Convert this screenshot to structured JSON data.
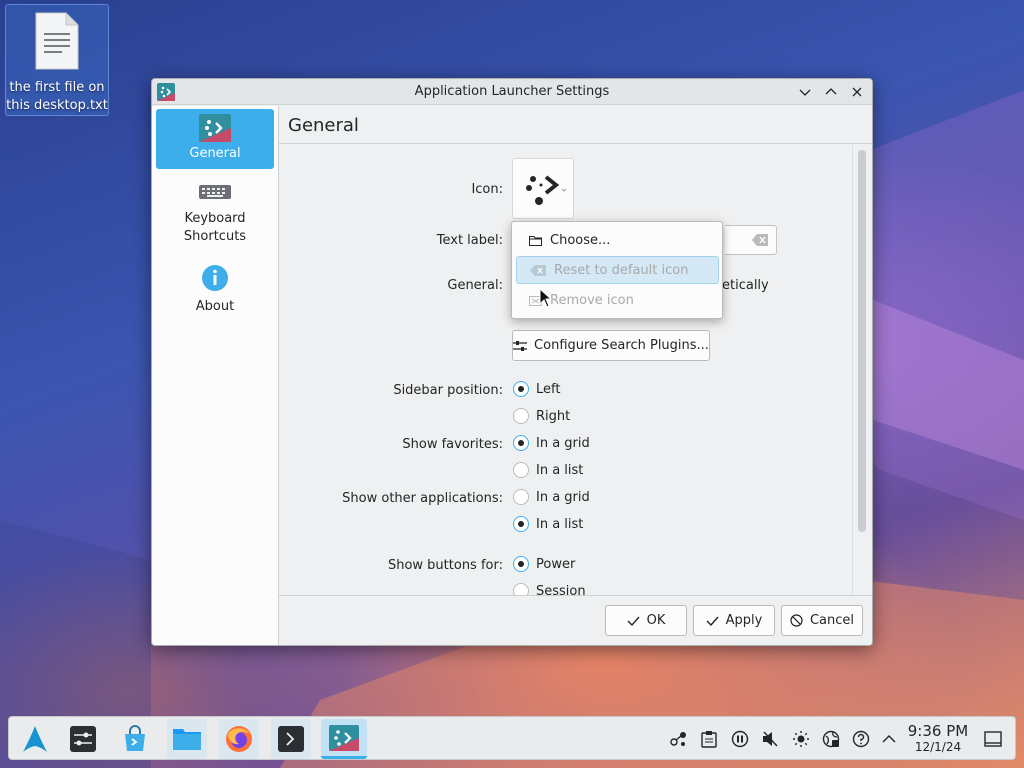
{
  "desktop": {
    "file_label": "the first file on this desktop.txt"
  },
  "window": {
    "title": "Application Launcher Settings",
    "accent": "#3daee9"
  },
  "sidebar": {
    "items": [
      {
        "label": "General",
        "icon": "app-launcher-icon",
        "active": true
      },
      {
        "label": "Keyboard Shortcuts",
        "icon": "keyboard-icon",
        "active": false
      },
      {
        "label": "About",
        "icon": "info-icon",
        "active": false
      }
    ]
  },
  "page": {
    "title": "General",
    "icon_label": "Icon:",
    "text_label_label": "Text label:",
    "general_label": "General:",
    "general_partial_text": "etically",
    "configure_button": "Configure Search Plugins...",
    "sidebar_position": {
      "label": "Sidebar position:",
      "options": [
        "Left",
        "Right"
      ],
      "selected": "Left"
    },
    "show_favorites": {
      "label": "Show favorites:",
      "options": [
        "In a grid",
        "In a list"
      ],
      "selected": "In a grid"
    },
    "show_other_apps": {
      "label": "Show other applications:",
      "options": [
        "In a grid",
        "In a list"
      ],
      "selected": "In a list"
    },
    "show_buttons_for": {
      "label": "Show buttons for:",
      "options": [
        "Power",
        "Session"
      ],
      "selected": "Power"
    }
  },
  "icon_menu": {
    "items": [
      {
        "label": "Choose...",
        "icon": "folder-icon",
        "state": "normal"
      },
      {
        "label": "Reset to default icon",
        "icon": "clear-icon",
        "state": "hover-disabled"
      },
      {
        "label": "Remove icon",
        "icon": "remove-icon",
        "state": "disabled"
      }
    ]
  },
  "footer": {
    "ok": "OK",
    "apply": "Apply",
    "cancel": "Cancel"
  },
  "taskbar": {
    "time": "9:36 PM",
    "date": "12/1/24"
  }
}
